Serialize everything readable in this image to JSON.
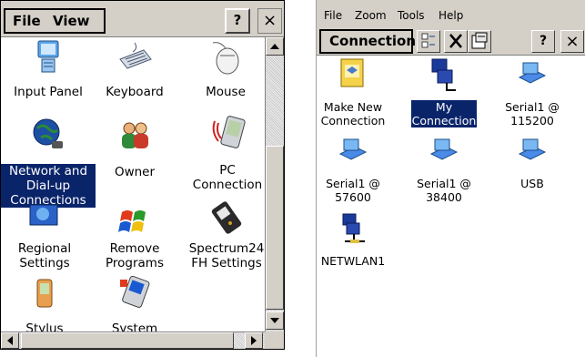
{
  "left": {
    "menu": {
      "file": "File",
      "view": "View"
    },
    "help": "?",
    "close": "×",
    "items": [
      {
        "label": "Input Panel"
      },
      {
        "label": "Keyboard"
      },
      {
        "label": "Mouse"
      },
      {
        "label1": "Network and",
        "label2": "Dial-up",
        "label3": "Connections",
        "selected": true
      },
      {
        "label": "Owner"
      },
      {
        "label1": "PC",
        "label2": "Connection"
      },
      {
        "label1": "Regional",
        "label2": "Settings"
      },
      {
        "label1": "Remove",
        "label2": "Programs"
      },
      {
        "label1": "Spectrum24",
        "label2": "FH Settings"
      },
      {
        "label": "Stylus"
      },
      {
        "label": "System"
      }
    ]
  },
  "right": {
    "menu": [
      "File",
      "Zoom",
      "Tools",
      "Help"
    ],
    "toolbar": {
      "connection": "Connection",
      "help": "?",
      "close": "×"
    },
    "items": [
      {
        "label1": "Make New",
        "label2": "Connection"
      },
      {
        "label1": "My",
        "label2": "Connection",
        "selected": true
      },
      {
        "label1": "Serial1 @",
        "label2": "115200"
      },
      {
        "label1": "Serial1 @",
        "label2": "57600"
      },
      {
        "label1": "Serial1 @",
        "label2": "38400"
      },
      {
        "label1": "USB"
      },
      {
        "label1": "NETWLAN1"
      }
    ]
  },
  "colors": {
    "selection": "#0a246a",
    "chrome": "#d4d0c8"
  }
}
